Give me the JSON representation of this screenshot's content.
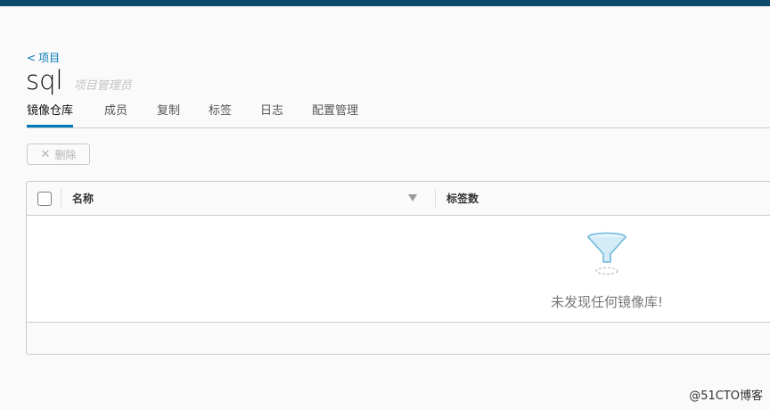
{
  "breadcrumb": {
    "back_label": "项目"
  },
  "project": {
    "name": "sql",
    "role": "项目管理员"
  },
  "tabs": [
    {
      "label": "镜像仓库",
      "active": true
    },
    {
      "label": "成员"
    },
    {
      "label": "复制"
    },
    {
      "label": "标签"
    },
    {
      "label": "日志"
    },
    {
      "label": "配置管理"
    }
  ],
  "toolbar": {
    "delete_label": "删除"
  },
  "grid": {
    "columns": [
      "名称",
      "标签数"
    ],
    "empty_message": "未发现任何镜像库!"
  },
  "watermark": "@51CTO博客",
  "colors": {
    "accent": "#0079b8",
    "topbar": "#0d4a6b"
  }
}
